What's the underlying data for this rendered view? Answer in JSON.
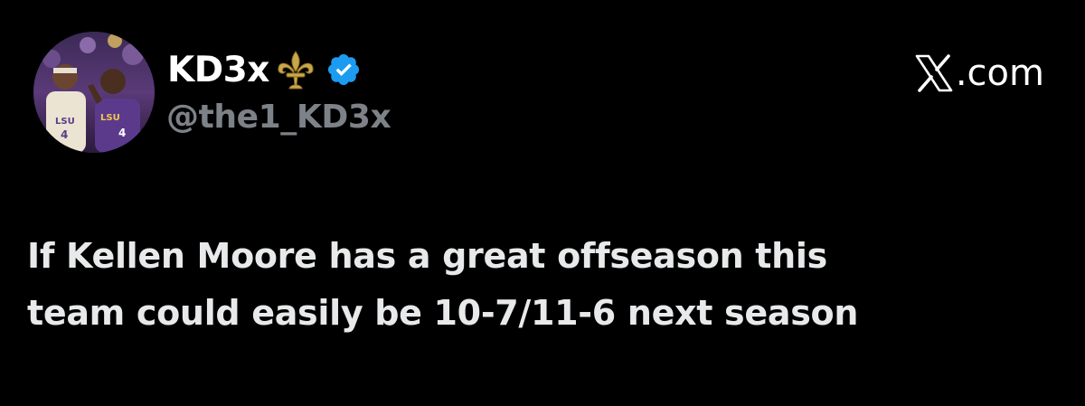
{
  "author": {
    "display_name": "KD3x",
    "handle": "@the1_KD3x",
    "verified": true,
    "name_emoji": "fleur-de-lis-icon"
  },
  "brand": {
    "logo": "x-logo-icon",
    "text": ".com"
  },
  "tweet": {
    "lines": [
      "If Kellen Moore has a great offseason this",
      "team could easily be 10-7/11-6 next season"
    ]
  },
  "colors": {
    "background": "#000000",
    "text": "#e7e9ea",
    "handle": "#7d8288",
    "verified": "#1d9bf0",
    "fleur": "#c9a84c"
  }
}
